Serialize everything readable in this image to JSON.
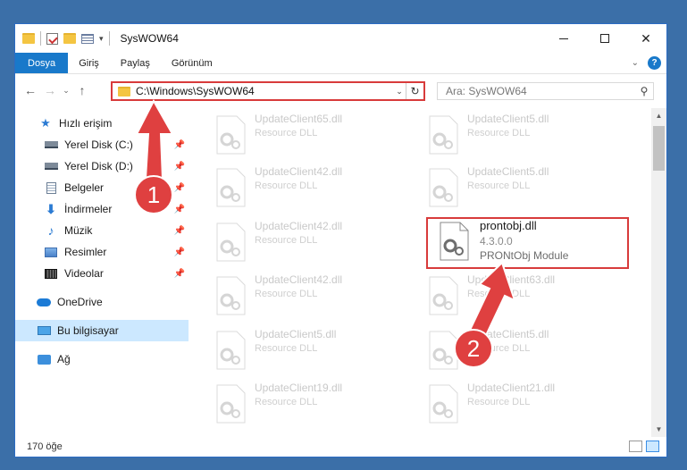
{
  "window": {
    "title": "SysWOW64"
  },
  "ribbon": {
    "tabs": [
      "Dosya",
      "Giriş",
      "Paylaş",
      "Görünüm"
    ]
  },
  "address": {
    "path": "C:\\Windows\\SysWOW64",
    "search_placeholder": "Ara: SysWOW64"
  },
  "nav": {
    "quick_access": "Hızlı erişim",
    "items": [
      "Yerel Disk (C:)",
      "Yerel Disk (D:)",
      "Belgeler",
      "İndirmeler",
      "Müzik",
      "Resimler",
      "Videolar"
    ],
    "onedrive": "OneDrive",
    "this_pc": "Bu bilgisayar",
    "network": "Ağ"
  },
  "files": [
    {
      "name": "UpdateClient65.dll",
      "desc": "Resource DLL"
    },
    {
      "name": "UpdateClient5.dll",
      "desc": "Resource DLL"
    },
    {
      "name": "UpdateClient42.dll",
      "desc": "Resource DLL"
    },
    {
      "name": "UpdateClient5.dll",
      "desc": "Resource DLL"
    },
    {
      "name": "UpdateClient42.dll",
      "desc": "Resource DLL"
    },
    {
      "name": "prontobj.dll",
      "version": "4.3.0.0",
      "desc": "PRONtObj Module"
    },
    {
      "name": "UpdateClient42.dll",
      "desc": "Resource DLL"
    },
    {
      "name": "UpdateClient63.dll",
      "desc": "Resource DLL"
    },
    {
      "name": "UpdateClient5.dll",
      "desc": "Resource DLL"
    },
    {
      "name": "UpdateClient5.dll",
      "desc": "Resource DLL"
    },
    {
      "name": "UpdateClient19.dll",
      "desc": "Resource DLL"
    },
    {
      "name": "UpdateClient21.dll",
      "desc": "Resource DLL"
    }
  ],
  "status": {
    "count": "170 öğe"
  },
  "annotations": {
    "step1": "1",
    "step2": "2",
    "color": "#df4040"
  }
}
